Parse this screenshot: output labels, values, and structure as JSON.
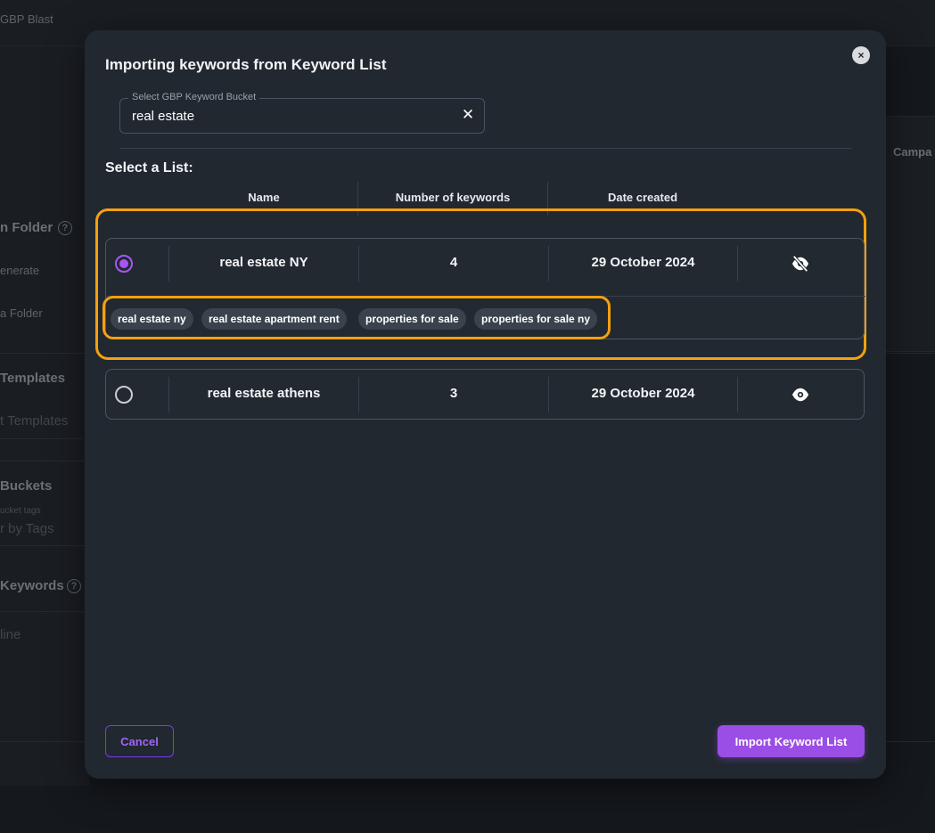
{
  "background": {
    "topbar_title": "GBP Blast",
    "right_label": "Campa",
    "sidebar": {
      "folder_title": "n Folder",
      "generate": "enerate",
      "a_folder": "a Folder",
      "templates_title": "Templates",
      "templates_sub": "t Templates",
      "buckets_title": "Buckets",
      "bucket_tags_label": "ucket tags",
      "filter_tags": "r by Tags",
      "keywords_title": "Keywords",
      "line_text": "line",
      "help_glyph": "?"
    }
  },
  "modal": {
    "title": "Importing keywords from Keyword List",
    "close_glyph": "×",
    "bucket_field": {
      "label": "Select GBP Keyword Bucket",
      "value": "real estate",
      "clear_glyph": "✕"
    },
    "section_title": "Select a List:",
    "columns": {
      "name": "Name",
      "count": "Number of keywords",
      "date": "Date created"
    },
    "rows": [
      {
        "name": "real estate NY",
        "count": "4",
        "date": "29 October 2024",
        "selected": true,
        "visibility_icon": "eye-off-icon",
        "tags": [
          "real estate ny",
          "real estate apartment rent",
          "properties for sale",
          "properties for sale ny"
        ]
      },
      {
        "name": "real estate athens",
        "count": "3",
        "date": "29 October 2024",
        "selected": false,
        "visibility_icon": "eye-icon"
      }
    ],
    "cancel_label": "Cancel",
    "import_label": "Import Keyword List"
  },
  "colors": {
    "accent": "#9b4ee6",
    "highlight": "#f5a00f",
    "modal_bg": "#212830"
  }
}
